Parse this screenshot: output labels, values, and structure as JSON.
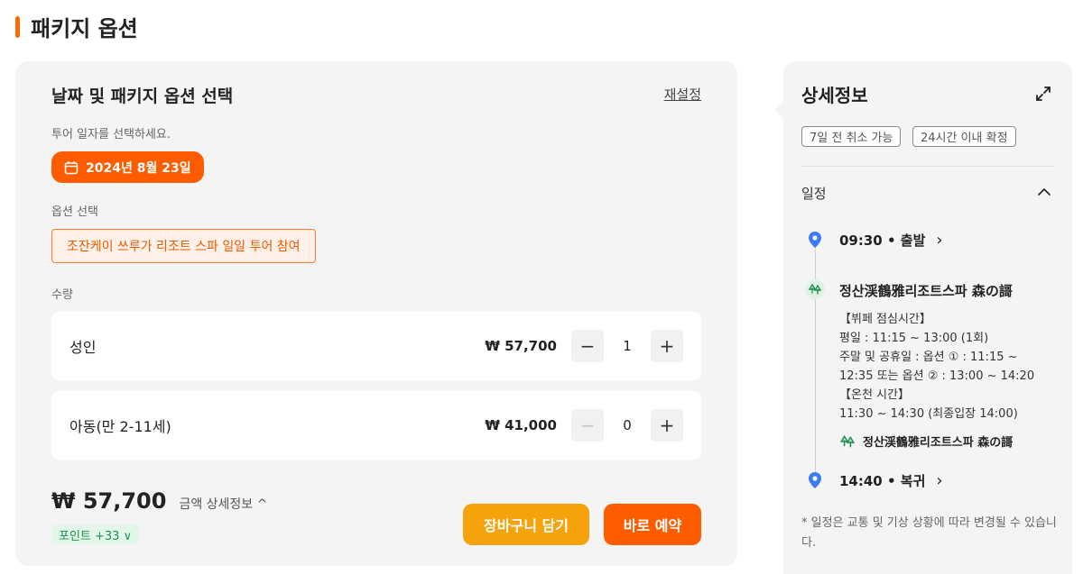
{
  "section": {
    "title": "패키지 옵션"
  },
  "left": {
    "heading": "날짜 및 패키지 옵션 선택",
    "reset": "재설정",
    "date_prompt": "투어 일자를 선택하세요.",
    "date": "2024년 8월 23일",
    "option_label": "옵션 선택",
    "option_chip": "조잔케이 쓰루가 리조트 스파 일일 투어 참여",
    "qty_label": "수량",
    "rows": [
      {
        "name": "성인",
        "price": "₩ 57,700",
        "count": "1",
        "minus": "−",
        "plus": "+"
      },
      {
        "name": "아동(만 2-11세)",
        "price": "₩ 41,000",
        "count": "0",
        "minus": "−",
        "plus": "+"
      }
    ],
    "total": "₩ 57,700",
    "total_detail": "금액 상세정보 ^",
    "points": "포인트 +33 ∨",
    "cart_button": "장바구니 담기",
    "book_button": "바로 예약"
  },
  "right": {
    "title": "상세정보",
    "tags": [
      "7일 전 취소 가능",
      "24시간 이내 확정"
    ],
    "schedule_label": "일정",
    "start": "09:30 • 출발",
    "poi": "정산渓鶴雅리조트스파 森の謌",
    "details": [
      "【뷔페 점심시간】",
      "평일 : 11:15 ~ 13:00 (1회)",
      "주말 및 공휴일 : 옵션 ① : 11:15 ~",
      "12:35 또는 옵션 ② : 13:00 ~ 14:20",
      "【온천 시간】",
      "11:30 ~ 14:30 (최종입장 14:00)"
    ],
    "poi_small": "정산渓鶴雅리조트스파 森の謌",
    "end": "14:40 • 복귀",
    "chevron": "›",
    "note": "* 일정은 교통 및 기상 상황에 따라 변경될 수 있습니다."
  },
  "colors": {
    "accent": "#ff5c00",
    "cart": "#f6a30b",
    "pin": "#3b7cf5",
    "green": "#1f8f4e"
  },
  "icons": [
    "calendar-icon",
    "expand-icon",
    "chevron-up-icon",
    "location-pin-icon",
    "tree-icon",
    "chevron-right-icon"
  ]
}
